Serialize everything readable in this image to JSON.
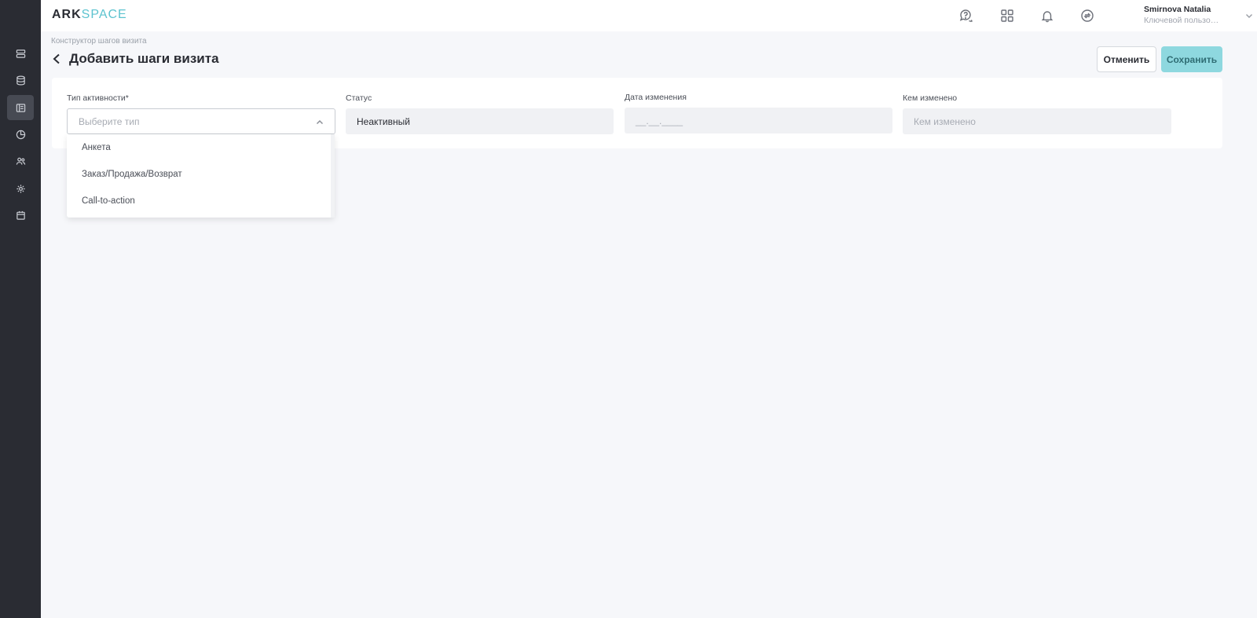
{
  "app": {
    "logo_part1": "ARK",
    "logo_part2": "SPACE"
  },
  "sidebar": {
    "items": [
      {
        "icon": "server-icon",
        "active": false
      },
      {
        "icon": "database-icon",
        "active": false
      },
      {
        "icon": "layout-icon",
        "active": true
      },
      {
        "icon": "pie-chart-icon",
        "active": false
      },
      {
        "icon": "users-icon",
        "active": false
      },
      {
        "icon": "gear-icon",
        "active": false
      },
      {
        "icon": "calendar-icon",
        "active": false
      }
    ]
  },
  "topbar": {
    "icons": [
      "help-chat-icon",
      "apps-grid-icon",
      "bell-icon",
      "sync-icon"
    ],
    "user": {
      "name": "Smirnova Natalia",
      "role": "Ключевой пользов..."
    }
  },
  "page": {
    "breadcrumb": "Конструктор шагов визита",
    "title": "Добавить шаги визита",
    "cancel_label": "Отменить",
    "save_label": "Сохранить"
  },
  "form": {
    "activity_type": {
      "label": "Тип активности*",
      "placeholder": "Выберите тип",
      "options": [
        "Анкета",
        "Заказ/Продажа/Возврат",
        "Call-to-action"
      ]
    },
    "status": {
      "label": "Статус",
      "value": "Неактивный"
    },
    "changed_date": {
      "label": "Дата изменения",
      "value": "__.__.____"
    },
    "changed_by": {
      "label": "Кем изменено",
      "placeholder": "Кем изменено"
    }
  },
  "colors": {
    "sidebar_bg": "#2a2c33",
    "accent": "#5cc3cf",
    "save_button_bg": "#8ed8df"
  }
}
